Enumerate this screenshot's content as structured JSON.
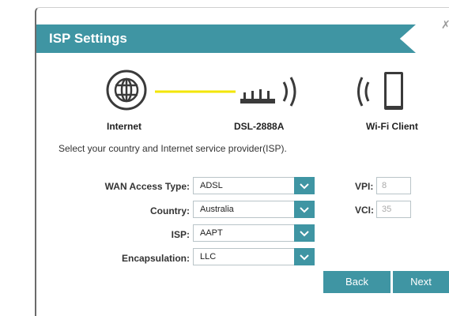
{
  "dialog": {
    "title": "ISP Settings",
    "close_glyph": "✗"
  },
  "diagram": {
    "internet_label": "Internet",
    "router_label": "DSL-2888A",
    "client_label": "Wi-Fi Client",
    "icons": [
      "globe-icon",
      "router-icon",
      "wifi-tablet-icon"
    ],
    "link_color": "#f3e600"
  },
  "instruction": "Select your country and Internet service provider(ISP).",
  "form": {
    "wan_label": "WAN Access Type:",
    "wan_value": "ADSL",
    "country_label": "Country:",
    "country_value": "Australia",
    "isp_label": "ISP:",
    "isp_value": "AAPT",
    "encap_label": "Encapsulation:",
    "encap_value": "LLC",
    "vpi_label": "VPI:",
    "vpi_value": "8",
    "vci_label": "VCI:",
    "vci_value": "35"
  },
  "buttons": {
    "back": "Back",
    "next": "Next"
  },
  "colors": {
    "accent": "#3f95a3"
  }
}
